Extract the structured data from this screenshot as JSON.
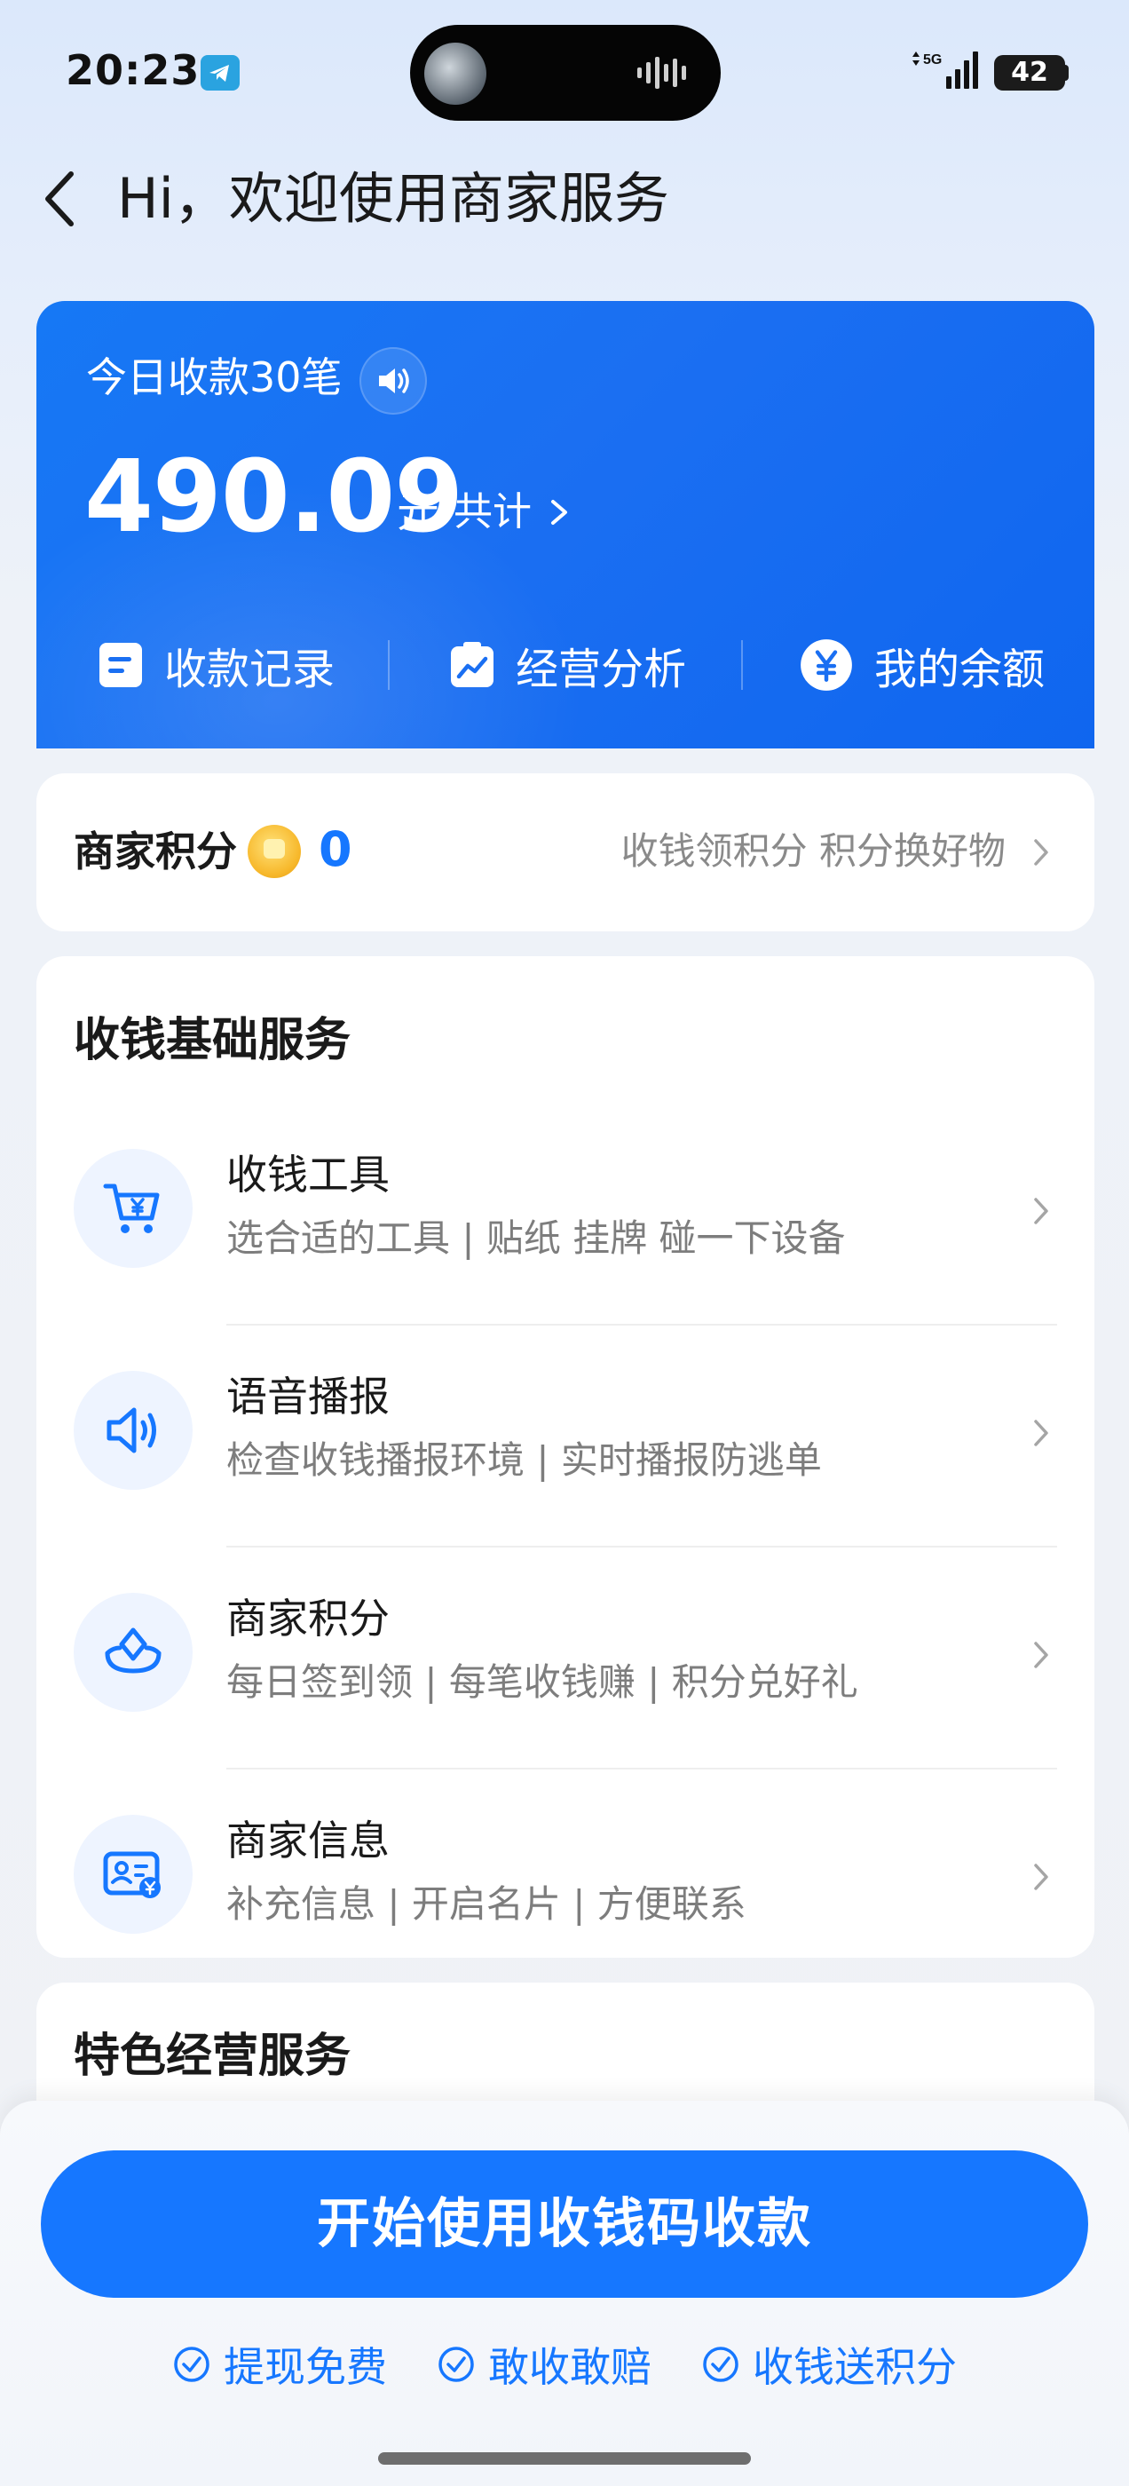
{
  "status_bar": {
    "time": "20:23",
    "network": "5G",
    "battery": "42"
  },
  "header": {
    "back_icon": "chevron-left-icon",
    "title": "Hi，欢迎使用商家服务"
  },
  "summary": {
    "today_count": "今日收款30笔",
    "amount": "490.09",
    "unit": "元",
    "total_link": "共计",
    "quick_actions": [
      {
        "label": "收款记录",
        "icon": "record-icon"
      },
      {
        "label": "经营分析",
        "icon": "analysis-icon"
      },
      {
        "label": "我的余额",
        "icon": "balance-icon"
      }
    ]
  },
  "points": {
    "label": "商家积分",
    "value": "0",
    "hint": "收钱领积分 积分换好物"
  },
  "basic_services": {
    "title": "收钱基础服务",
    "items": [
      {
        "title": "收钱工具",
        "subtitle": "选合适的工具 | 贴纸 挂牌 碰一下设备",
        "icon": "cart-icon"
      },
      {
        "title": "语音播报",
        "subtitle": "检查收钱播报环境 | 实时播报防逃单",
        "icon": "speaker-icon"
      },
      {
        "title": "商家积分",
        "subtitle": "每日签到领 | 每笔收钱赚 | 积分兑好礼",
        "icon": "points-icon"
      },
      {
        "title": "商家信息",
        "subtitle": "补充信息 | 开启名片 | 方便联系",
        "icon": "id-card-icon"
      }
    ]
  },
  "featured_services": {
    "title": "特色经营服务"
  },
  "cta": {
    "label": "开始使用收钱码收款"
  },
  "perks": [
    "提现免费",
    "敢收敢赔",
    "收钱送积分"
  ],
  "colors": {
    "primary": "#1677ff",
    "card_gradient_start": "#1678f5",
    "card_gradient_end": "#0f66ef"
  }
}
